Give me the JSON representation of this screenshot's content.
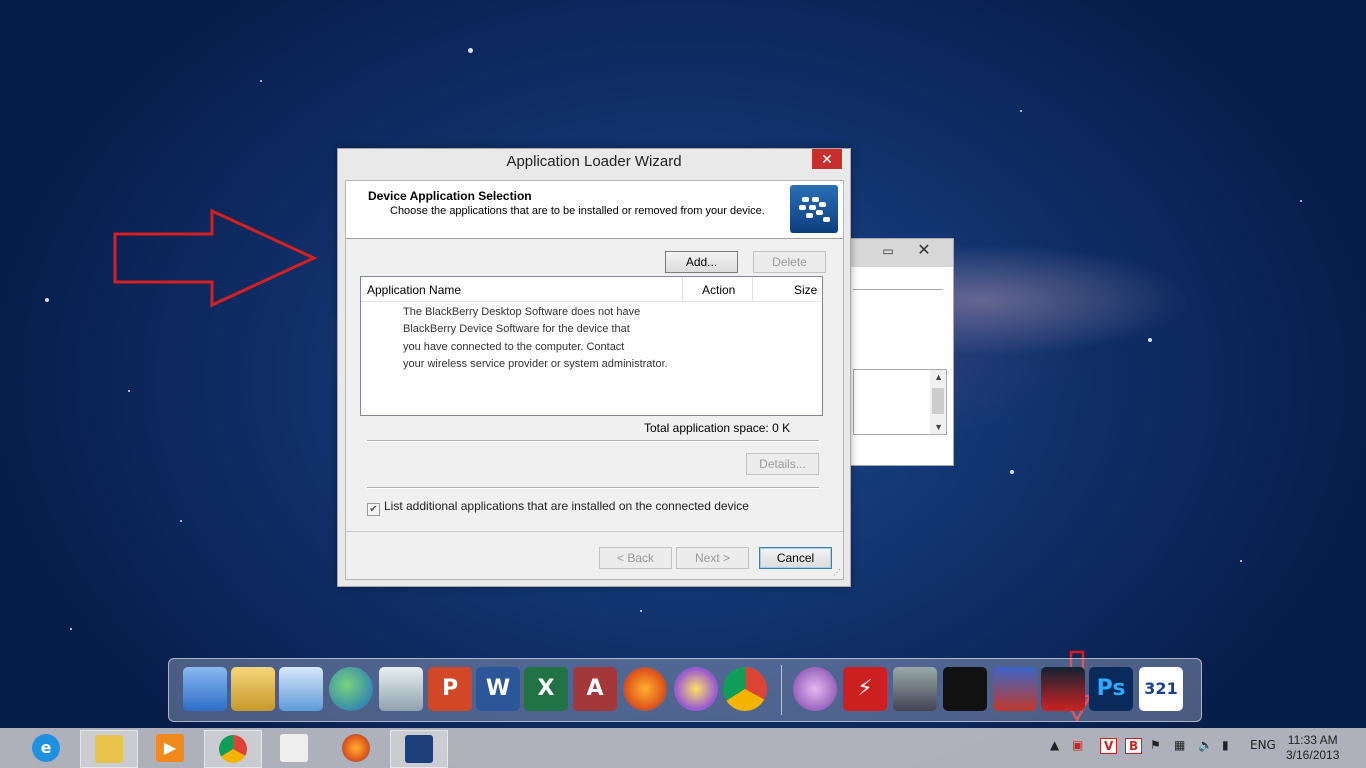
{
  "dialog": {
    "title": "Application Loader Wizard",
    "close_glyph": "✕",
    "header_title": "Device Application Selection",
    "header_subtitle": "Choose the applications that are to be installed or removed from your device.",
    "add_label": "Add...",
    "delete_label": "Delete",
    "columns": [
      "Application Name",
      "Action",
      "Size"
    ],
    "message_lines": [
      "The BlackBerry Desktop Software does not have",
      "BlackBerry Device Software for the device that",
      "you have connected to the computer. Contact",
      "your wireless service provider or system administrator."
    ],
    "total_label": "Total application space:",
    "total_value": "0 K",
    "details_label": "Details...",
    "checkbox_label": "List additional applications that are installed on the connected device",
    "checkbox_checked": true,
    "back_label": "< Back",
    "next_label": "Next >",
    "cancel_label": "Cancel"
  },
  "background_window": {
    "minimize_glyph": "▭",
    "close_glyph": "✕"
  },
  "dock": {
    "icons": [
      "computer-icon",
      "user-folder-icon",
      "control-panel-icon",
      "network-icon",
      "recycle-bin-icon",
      "powerpoint-icon",
      "word-icon",
      "excel-icon",
      "access-icon",
      "firefox-icon",
      "yahoo-messenger-icon",
      "chrome-icon",
      "itunes-icon",
      "flash-icon",
      "chip-icon",
      "blackberry-icon",
      "star-wars-icon",
      "angry-birds-space-icon",
      "photoshop-icon",
      "media-player-classic-icon"
    ],
    "labels": {
      "powerpoint": "P",
      "word": "W",
      "excel": "X",
      "access": "A",
      "photoshop": "Ps",
      "mpc": "321"
    }
  },
  "taskbar": {
    "items": [
      "internet-explorer",
      "file-explorer",
      "media-player",
      "chrome",
      "unknown-app",
      "firefox",
      "blackberry-desktop"
    ],
    "tray": {
      "language": "ENG",
      "time": "11:33 AM",
      "date": "3/16/2013"
    }
  }
}
